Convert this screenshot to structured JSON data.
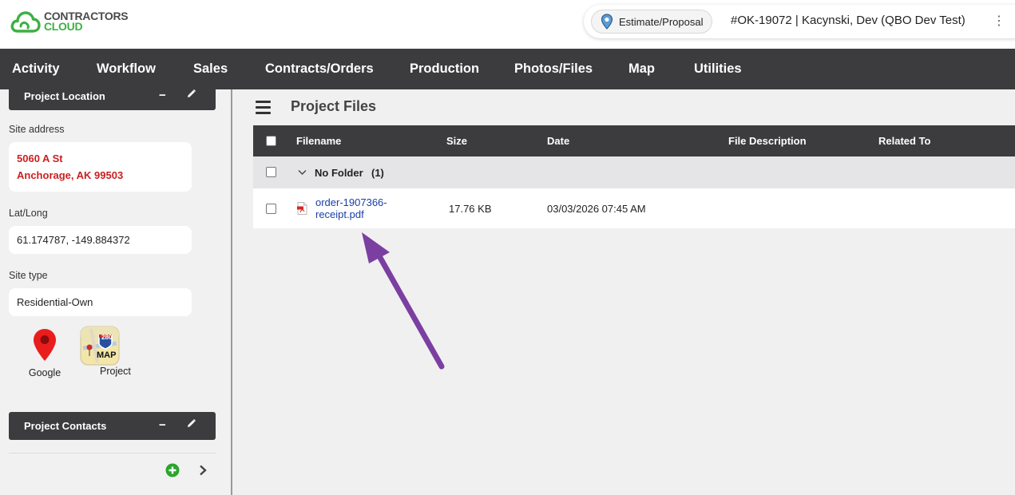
{
  "brand": {
    "line1": "CONTRACTORS",
    "line2": "CLOUD"
  },
  "job": {
    "type_label": "Estimate/Proposal",
    "title": "#OK-19072 | Kacynski, Dev (QBO Dev Test)",
    "menu_icon": "kebab-icon"
  },
  "nav": [
    "Activity",
    "Workflow",
    "Sales",
    "Contracts/Orders",
    "Production",
    "Photos/Files",
    "Map",
    "Utilities"
  ],
  "sidebar": {
    "location_panel": {
      "title": "Project Location"
    },
    "site_address_label": "Site address",
    "address_line1": "5060 A St",
    "address_line2": "Anchorage, AK 99503",
    "latlong_label": "Lat/Long",
    "latlong_value": "61.174787, -149.884372",
    "site_type_label": "Site type",
    "site_type_value": "Residential-Own",
    "google_label": "Google",
    "project_label": "Project",
    "map_badge": "MAP",
    "map_shield": "280",
    "contacts_panel": {
      "title": "Project Contacts"
    }
  },
  "main": {
    "title": "Project Files",
    "columns": [
      "Filename",
      "Size",
      "Date",
      "File Description",
      "Related To"
    ],
    "folder": {
      "label": "No Folder",
      "count": "(1)"
    },
    "files": [
      {
        "name_line1": "order-1907366-",
        "name_line2": "receipt.pdf",
        "size": "17.76 KB",
        "date": "03/03/2026 07:45 AM",
        "description": "",
        "related": ""
      }
    ]
  },
  "colors": {
    "nav_bg": "#3c3b3e",
    "brand_green": "#3cb043",
    "address_red": "#cc1f1f",
    "arrow": "#7b3fa1",
    "link_blue": "#1a3fa8"
  }
}
